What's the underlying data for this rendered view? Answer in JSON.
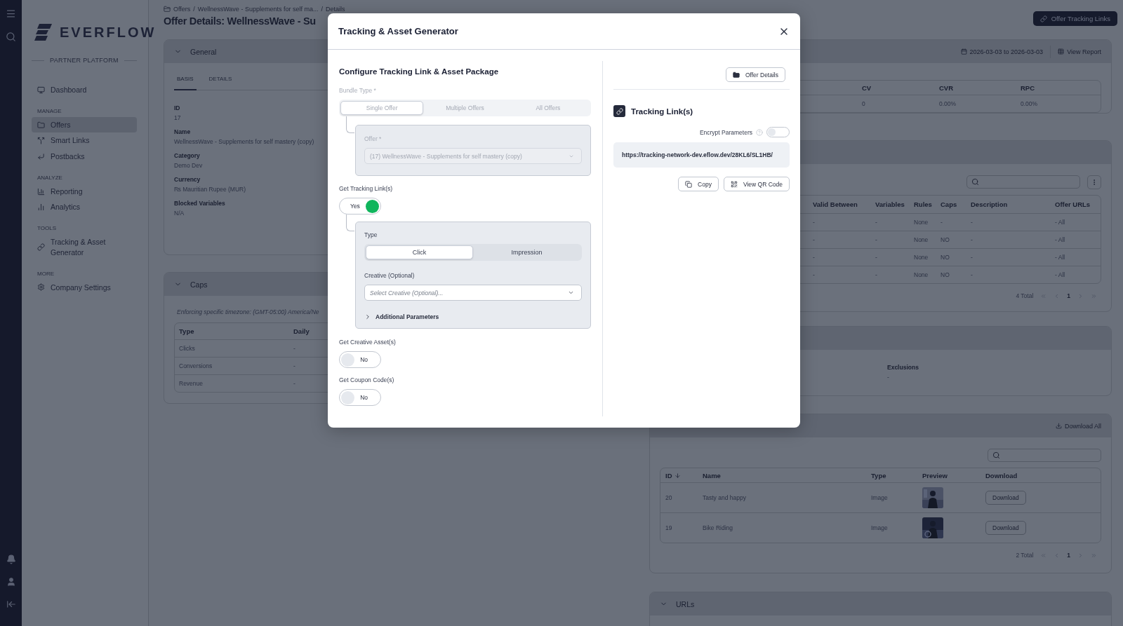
{
  "sidebar": {
    "logo": "EVERFLOW",
    "platform": "PARTNER PLATFORM",
    "sections": [
      {
        "items": [
          {
            "label": "Dashboard",
            "selected": false
          }
        ]
      },
      {
        "heading": "MANAGE",
        "items": [
          {
            "label": "Offers",
            "selected": true
          },
          {
            "label": "Smart Links",
            "selected": false
          },
          {
            "label": "Postbacks",
            "selected": false
          }
        ]
      },
      {
        "heading": "ANALYZE",
        "items": [
          {
            "label": "Reporting",
            "selected": false
          },
          {
            "label": "Analytics",
            "selected": false
          }
        ]
      },
      {
        "heading": "TOOLS",
        "items": [
          {
            "label": "Tracking & Asset Generator",
            "selected": false
          }
        ]
      },
      {
        "heading": "MORE",
        "items": [
          {
            "label": "Company Settings",
            "selected": false
          }
        ]
      }
    ]
  },
  "header": {
    "breadcrumb": [
      "Offers",
      "WellnessWave - Supplements for self ma...",
      "Details"
    ],
    "separator": "/",
    "title": "Offer Details: WellnessWave - Su",
    "action": "Offer Tracking Links"
  },
  "general": {
    "title": "General",
    "tabs": [
      {
        "label": "BASIS",
        "selected": true
      },
      {
        "label": "DETAILS",
        "selected": false
      }
    ],
    "fields": [
      {
        "label": "ID",
        "value": "17"
      },
      {
        "label": "Name",
        "value": "WellnessWave - Supplements for self mastery (copy)"
      },
      {
        "label": "Category",
        "value": "Demo Dev"
      },
      {
        "label": "Currency",
        "value": "₨ Mauritian Rupee (MUR)"
      },
      {
        "label": "Blocked Variables",
        "value": "N/A"
      }
    ]
  },
  "caps": {
    "title": "Caps",
    "note": "Enforcing specific timezone: (GMT-05:00) America/Ne",
    "columns": [
      "Type",
      "Daily"
    ],
    "rows": [
      [
        "Clicks",
        "-"
      ],
      [
        "Conversions",
        "-"
      ],
      [
        "Revenue",
        "-"
      ]
    ]
  },
  "stats": {
    "date_range": "2026-03-03 to 2026-03-03",
    "view_report": "View Report",
    "columns": [
      "CV",
      "CVR",
      "RPC"
    ],
    "row": [
      "0",
      "0.00%",
      "0.00%"
    ]
  },
  "tracking_links": {
    "columns": [
      "Valid Between",
      "Variables",
      "Rules",
      "Caps",
      "Description",
      "Offer URLs"
    ],
    "rows": [
      [
        "-",
        "-",
        "None",
        "-",
        "-",
        "- All"
      ],
      [
        "-",
        "-",
        "None",
        "NO",
        "-",
        "- All"
      ],
      [
        "-",
        "-",
        "None",
        "NO",
        "-",
        "- All"
      ],
      [
        "-",
        "-",
        "None",
        "NO",
        "-",
        "- All"
      ]
    ],
    "pagination": {
      "total": "4 Total",
      "page": "1"
    }
  },
  "targeting": {
    "fields": [
      {
        "label": "Exclusions",
        "value": "-"
      }
    ]
  },
  "creatives": {
    "download_all": "Download All",
    "columns": [
      "ID",
      "Name",
      "Type",
      "Preview",
      "Download"
    ],
    "rows": [
      {
        "id": "20",
        "name": "Tasty and happy",
        "type": "Image",
        "action": "Download"
      },
      {
        "id": "19",
        "name": "Bike Riding",
        "type": "Image",
        "action": "Download"
      }
    ],
    "pagination": {
      "total": "2 Total",
      "page": "1"
    }
  },
  "urls": {
    "title": "URLs"
  },
  "modal": {
    "title": "Tracking & Asset Generator",
    "heading": "Configure Tracking Link & Asset Package",
    "bundle": {
      "label": "Bundle Type *",
      "disabled": true,
      "options": [
        {
          "label": "Single Offer",
          "selected": true
        },
        {
          "label": "Multiple Offers",
          "selected": false
        },
        {
          "label": "All Offers",
          "selected": false
        }
      ]
    },
    "offer": {
      "label": "Offer *",
      "value": "(17) WellnessWave - Supplements for self mastery (copy)",
      "disabled": true
    },
    "tracking": {
      "label": "Get Tracking Link(s)",
      "text": "Yes",
      "on": true
    },
    "type": {
      "label": "Type",
      "options": [
        {
          "label": "Click",
          "selected": true
        },
        {
          "label": "Impression",
          "selected": false
        }
      ]
    },
    "creative": {
      "label": "Creative (Optional)",
      "placeholder": "Select Creative (Optional)..."
    },
    "additional": {
      "label": "Additional Parameters",
      "expanded": false
    },
    "creative_asset": {
      "label": "Get Creative Asset(s)",
      "text": "No",
      "on": false
    },
    "coupon": {
      "label": "Get Coupon Code(s)",
      "text": "No",
      "on": false
    },
    "offer_details": "Offer Details",
    "links_title": "Tracking Link(s)",
    "encrypt": {
      "label": "Encrypt Parameters",
      "on": false
    },
    "url": "https://tracking-network-dev.eflow.dev/28KL6/SL1HB/",
    "buttons": [
      "Copy",
      "View QR Code"
    ]
  }
}
